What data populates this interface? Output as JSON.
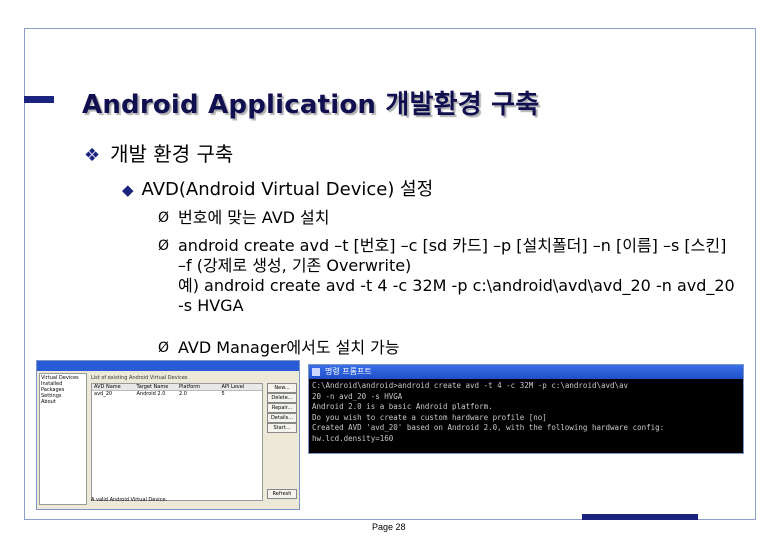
{
  "slide": {
    "title": "Android Application 개발환경 구축",
    "l1": "개발 환경 구축",
    "l2": "AVD(Android Virtual Device) 설정",
    "bullets": [
      "번호에 맞는 AVD 설치",
      "android create avd –t [번호] –c [sd 카드] –p [설치폴더] –n [이름] –s [스킨] –f (강제로 생성, 기존 Overwrite)",
      "예) android create avd -t 4 -c 32M -p c:\\android\\avd\\avd_20 -n avd_20 -s HVGA",
      "AVD Manager에서도 설치 가능"
    ],
    "marker_l1": "❖",
    "marker_l2": "◆",
    "marker_l3": "Ø",
    "page": "Page 28"
  },
  "left_screenshot": {
    "sidebar": [
      "Virtual Devices",
      "Installed Packages",
      "Settings",
      "About"
    ],
    "header": "List of existing Android Virtual Devices",
    "columns": [
      "AVD Name",
      "Target Name",
      "Platform",
      "API Level"
    ],
    "rows": [
      [
        "avd_20",
        "Android 2.0",
        "2.0",
        "5"
      ]
    ],
    "buttons": [
      "New...",
      "Delete...",
      "Repair...",
      "Details...",
      "Start...",
      "Refresh"
    ],
    "footer": "A valid Android Virtual Device."
  },
  "cmd": {
    "title": "명령 프롬프트",
    "lines": [
      "C:\\Android\\android>android create avd -t 4 -c 32M -p c:\\android\\avd\\av",
      "20 -n avd_20 -s HVGA",
      "Android 2.0 is a basic Android platform.",
      "Do you wish to create a custom hardware profile [no]",
      "Created AVD 'avd_20' based on Android 2.0, with the following hardware config:",
      "hw.lcd.density=160"
    ]
  }
}
